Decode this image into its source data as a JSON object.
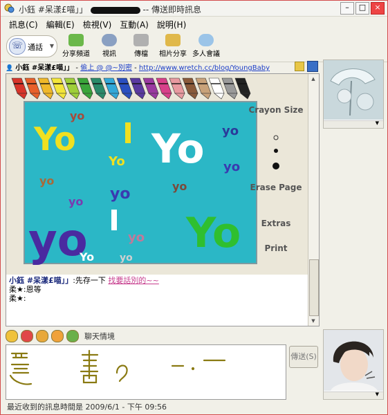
{
  "window": {
    "title_left": "小鈺 #呆漾£喵」」",
    "title_right": "-- 傳送即時訊息"
  },
  "menu": [
    "訊息(C)",
    "編輯(E)",
    "檢視(V)",
    "互動(A)",
    "說明(H)"
  ],
  "toolbar": {
    "call_label": "通話",
    "tools": [
      {
        "label": "分享頻道",
        "color": "#6bb84a"
      },
      {
        "label": "視訊",
        "color": "#8aa0c2"
      },
      {
        "label": "傳檔",
        "color": "#b0b0b0"
      },
      {
        "label": "相片分享",
        "color": "#e0b84a"
      },
      {
        "label": "多人會議",
        "color": "#9bc4e8"
      }
    ]
  },
  "info_bar": {
    "name": "小鈺 #呆漾£喵」」",
    "status_prefix": " - ",
    "status_link": "偷上 @ @~別密",
    "url_prefix": " - ",
    "url": "http://www.wretch.cc/blog/YoungBaby"
  },
  "drawing": {
    "side_labels": [
      "Crayon Size",
      "Erase Page",
      "Extras",
      "Print"
    ],
    "crayon_colors": [
      "#d8352a",
      "#e8602a",
      "#f0b82a",
      "#f3e53a",
      "#9fcf3a",
      "#3aa53a",
      "#2a8a6a",
      "#33a8d8",
      "#2a4fc0",
      "#5a3aa0",
      "#9a3aa0",
      "#d8408a",
      "#e89aa0",
      "#8a5a3a",
      "#c8a27a",
      "#ffffff",
      "#9a9a9a",
      "#222222"
    ],
    "canvas_color": "#2bb7c6",
    "yo_marks": [
      "Yo",
      "Yo",
      "yo",
      "Yo",
      "yo",
      "yo",
      "yo",
      "Yo",
      "yo",
      "yo",
      "yo",
      "yo",
      "Yo",
      "yo",
      "yo"
    ]
  },
  "messages": [
    {
      "sender": "小鈺 #呆漾£喵」」",
      "sep": ":",
      "text": "先存一下",
      "link": "找要話別的~~"
    },
    {
      "sender": "柔★",
      "sep": ":",
      "text": "恩等"
    },
    {
      "sender": "柔★",
      "sep": ":",
      "text": ""
    }
  ],
  "emote_bar": {
    "label": "聊天情境",
    "colors": [
      "#f0c23a",
      "#e04848",
      "#e8a83a",
      "#f0a23a",
      "#6ab04a"
    ]
  },
  "input": {
    "handwriting": "還 畫 ? - . -"
  },
  "send_label": "傳送(S)",
  "status_text": "最近收到的訊息時間是 2009/6/1 - 下午 09:56"
}
